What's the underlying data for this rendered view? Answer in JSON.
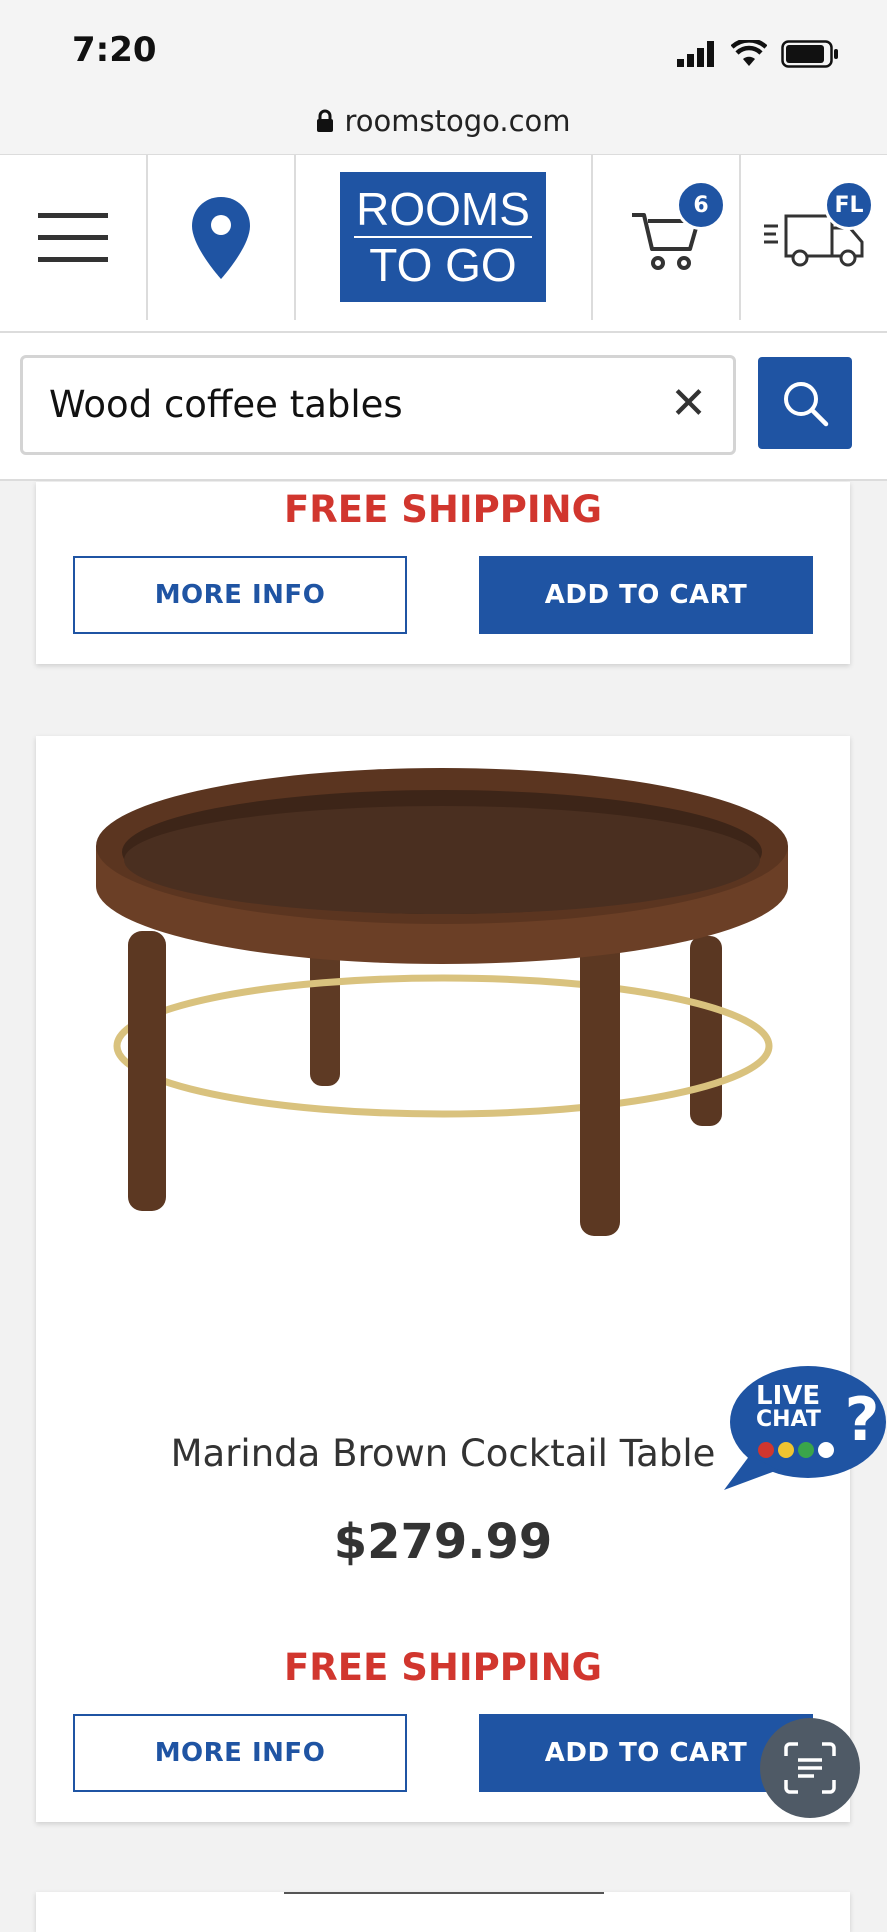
{
  "status_bar": {
    "time": "7:20"
  },
  "browser": {
    "url": "roomstogo.com"
  },
  "header": {
    "logo_line1": "ROOMS",
    "logo_line2": "TO GO",
    "cart_count": "6",
    "delivery_state": "FL"
  },
  "search": {
    "value": "Wood coffee tables",
    "clear_symbol": "✕"
  },
  "cards": [
    {
      "shipping": "FREE SHIPPING",
      "more_info": "MORE INFO",
      "add_to_cart": "ADD TO CART"
    },
    {
      "name": "Marinda Brown Cocktail Table",
      "price": "$279.99",
      "shipping": "FREE SHIPPING",
      "more_info": "MORE INFO",
      "add_to_cart": "ADD TO CART"
    }
  ],
  "live_chat": {
    "line1": "LIVE",
    "line2": "CHAT"
  },
  "colors": {
    "brand_blue": "#1f54a3",
    "shipping_red": "#d1362e"
  }
}
